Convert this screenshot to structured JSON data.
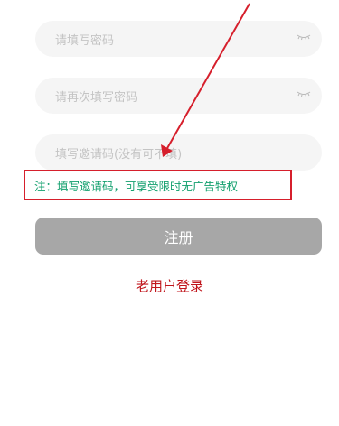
{
  "form": {
    "password_placeholder": "请填写密码",
    "confirm_placeholder": "请再次填写密码",
    "invite_placeholder": "填写邀请码(没有可不填)"
  },
  "note": {
    "text": "注：填写邀请码，可享受限时无广告特权"
  },
  "actions": {
    "register_label": "注册",
    "old_user_login": "老用户登录"
  },
  "colors": {
    "note_text": "#13a06e",
    "annotation_red": "#d61f2c",
    "login_link": "#c0161c",
    "button_bg": "#a7a7a7"
  }
}
